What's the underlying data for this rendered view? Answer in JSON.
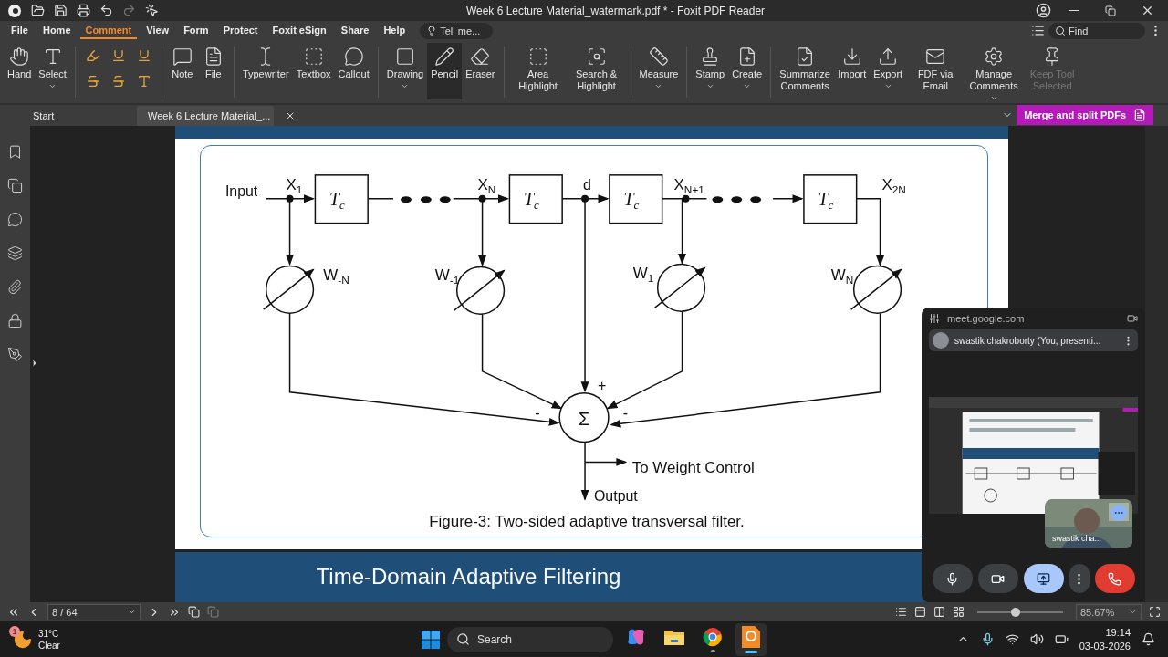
{
  "window": {
    "title": "Week 6 Lecture Material_watermark.pdf * - Foxit PDF Reader"
  },
  "menu": [
    {
      "label": "File",
      "selected": false
    },
    {
      "label": "Home",
      "selected": false
    },
    {
      "label": "Comment",
      "selected": true
    },
    {
      "label": "View",
      "selected": false
    },
    {
      "label": "Form",
      "selected": false
    },
    {
      "label": "Protect",
      "selected": false
    },
    {
      "label": "Foxit eSign",
      "selected": false
    },
    {
      "label": "Share",
      "selected": false
    },
    {
      "label": "Help",
      "selected": false
    }
  ],
  "tell_me": {
    "placeholder": "Tell me..."
  },
  "find": {
    "placeholder": "Find"
  },
  "ribbon": [
    {
      "label": "Hand",
      "selected": false,
      "disabled": false,
      "dropdown": false
    },
    {
      "label": "Select",
      "selected": false,
      "disabled": false,
      "dropdown": true
    },
    {
      "label": "Note",
      "selected": false,
      "disabled": false,
      "dropdown": false
    },
    {
      "label": "File",
      "selected": false,
      "disabled": false,
      "dropdown": false
    },
    {
      "label": "Typewriter",
      "selected": false,
      "disabled": false,
      "dropdown": false
    },
    {
      "label": "Textbox",
      "selected": false,
      "disabled": false,
      "dropdown": false
    },
    {
      "label": "Callout",
      "selected": false,
      "disabled": false,
      "dropdown": false
    },
    {
      "label": "Drawing",
      "selected": false,
      "disabled": false,
      "dropdown": true
    },
    {
      "label": "Pencil",
      "selected": true,
      "disabled": false,
      "dropdown": false
    },
    {
      "label": "Eraser",
      "selected": false,
      "disabled": false,
      "dropdown": false
    },
    {
      "label": "Area Highlight",
      "selected": false,
      "disabled": false,
      "dropdown": false
    },
    {
      "label": "Search & Highlight",
      "selected": false,
      "disabled": false,
      "dropdown": false
    },
    {
      "label": "Measure",
      "selected": false,
      "disabled": false,
      "dropdown": true
    },
    {
      "label": "Stamp",
      "selected": false,
      "disabled": false,
      "dropdown": true
    },
    {
      "label": "Create",
      "selected": false,
      "disabled": false,
      "dropdown": true
    },
    {
      "label": "Summarize Comments",
      "selected": false,
      "disabled": false,
      "dropdown": false
    },
    {
      "label": "Import",
      "selected": false,
      "disabled": false,
      "dropdown": false
    },
    {
      "label": "Export",
      "selected": false,
      "disabled": false,
      "dropdown": true
    },
    {
      "label": "FDF via Email",
      "selected": false,
      "disabled": false,
      "dropdown": false
    },
    {
      "label": "Manage Comments",
      "selected": false,
      "disabled": false,
      "dropdown": true
    },
    {
      "label": "Keep Tool Selected",
      "selected": false,
      "disabled": true,
      "dropdown": false
    }
  ],
  "doc_tabs": [
    {
      "label": "Start",
      "selected": false,
      "closable": false
    },
    {
      "label": "Week 6 Lecture Material_...",
      "selected": true,
      "closable": true
    }
  ],
  "promo_button": "Merge and split PDFs",
  "figure": {
    "input": "Input",
    "taps": [
      {
        "base": "X",
        "sub": "1"
      },
      {
        "base": "X",
        "sub": "N"
      },
      {
        "base": "X",
        "sub": "N+1"
      },
      {
        "base": "X",
        "sub": "2N"
      }
    ],
    "delays": [
      {
        "base": "T",
        "sub": "c"
      },
      {
        "base": "T",
        "sub": "c"
      },
      {
        "base": "T",
        "sub": "c"
      },
      {
        "base": "T",
        "sub": "c"
      }
    ],
    "d": "d",
    "weights": [
      {
        "base": "W",
        "sub": "-N"
      },
      {
        "base": "W",
        "sub": "-1"
      },
      {
        "base": "W",
        "sub": "1"
      },
      {
        "base": "W",
        "sub": "N"
      }
    ],
    "signs": [
      "+",
      "-",
      "-"
    ],
    "sum": "Σ",
    "weight_control": "To Weight Control",
    "output": "Output",
    "caption": "Figure-3: Two-sided adaptive transversal filter."
  },
  "next_slide_title": "Time-Domain Adaptive Filtering",
  "status": {
    "page": "8 / 64",
    "zoom": "85.67%",
    "zoom_slider": {
      "level": 0.45
    }
  },
  "meet": {
    "site": "meet.google.com",
    "presenter": "swastik chakroborty (You, presenti...",
    "self_name": "swastik cha..."
  },
  "taskbar": {
    "weather_badge": "1",
    "temperature": "31°C",
    "condition": "Clear",
    "search": "Search",
    "apps": [
      {
        "kind": "copilot",
        "active": false,
        "open": false
      },
      {
        "kind": "folder",
        "active": false,
        "open": false
      },
      {
        "kind": "chrome",
        "active": false,
        "open": true
      },
      {
        "kind": "foxit",
        "active": true,
        "open": true
      }
    ],
    "time": "19:14",
    "date": "03-03-2026"
  }
}
